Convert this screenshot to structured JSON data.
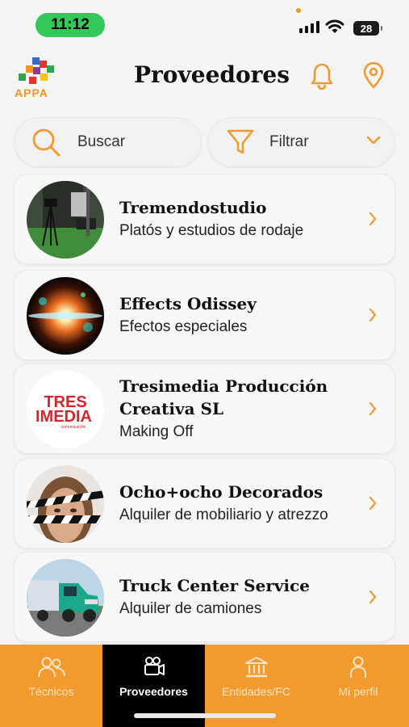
{
  "status_bar": {
    "time": "11:12",
    "battery": "28"
  },
  "header": {
    "logo_text": "APPA",
    "title": "Proveedores"
  },
  "search": {
    "label": "Buscar"
  },
  "filter": {
    "label": "Filtrar"
  },
  "providers": [
    {
      "name": "Tremendostudio",
      "category": "Platós y estudios de rodaje"
    },
    {
      "name": "Effects Odissey",
      "category": "Efectos especiales"
    },
    {
      "name": "Tresimedia Producción Creativa SL",
      "category": "Making Off",
      "logo_line1": "TRES",
      "logo_line2": "IMEDIA",
      "logo_tag": "comunicación"
    },
    {
      "name": "Ocho+ocho Decorados",
      "category": "Alquiler de mobiliario y atrezzo"
    },
    {
      "name": "Truck Center Service",
      "category": "Alquiler de camiones"
    }
  ],
  "nav": [
    {
      "label": "Técnicos",
      "icon": "people-icon",
      "active": false
    },
    {
      "label": "Proveedores",
      "icon": "camera-icon",
      "active": true
    },
    {
      "label": "Entidades/FC",
      "icon": "building-icon",
      "active": false
    },
    {
      "label": "Mi perfil",
      "icon": "person-icon",
      "active": false
    }
  ],
  "colors": {
    "accent": "#f29a2e",
    "active_nav": "#000000",
    "status_green": "#34c759"
  }
}
